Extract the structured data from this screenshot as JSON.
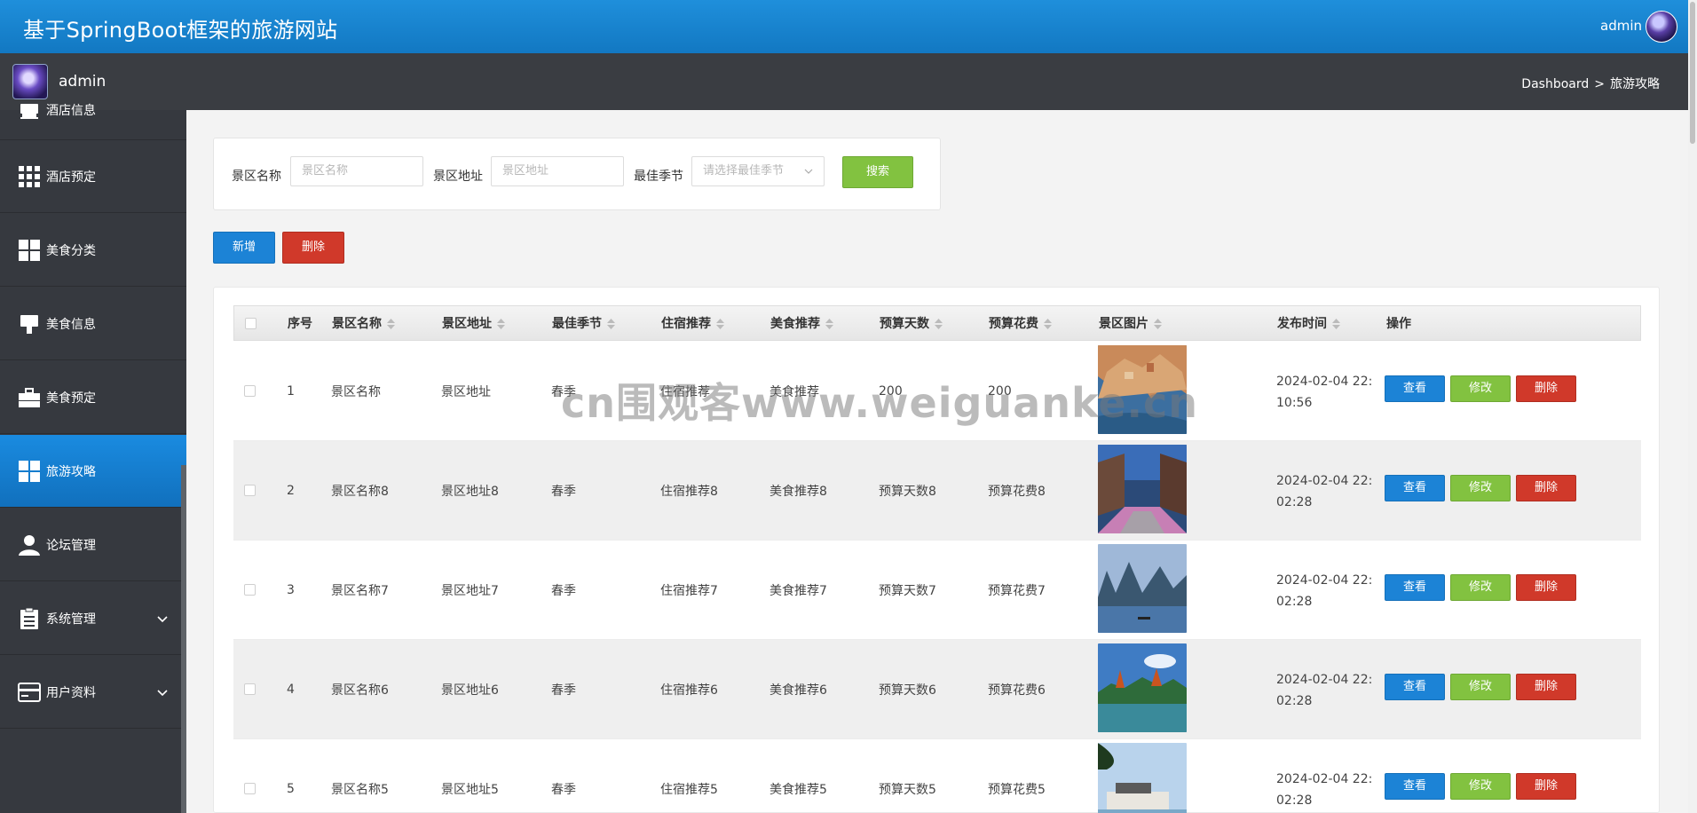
{
  "header": {
    "title": "基于SpringBoot框架的旅游网站",
    "user": "admin"
  },
  "subheader": {
    "user": "admin",
    "breadcrumb": [
      "Dashboard",
      ">",
      "旅游攻略"
    ]
  },
  "sidebar": {
    "items": [
      {
        "label": "酒店信息",
        "icon": "hotel-icon"
      },
      {
        "label": "酒店预定",
        "icon": "grid-icon"
      },
      {
        "label": "美食分类",
        "icon": "category-icon"
      },
      {
        "label": "美食信息",
        "icon": "food-icon"
      },
      {
        "label": "美食预定",
        "icon": "briefcase-icon"
      },
      {
        "label": "旅游攻略",
        "icon": "category-icon",
        "active": true
      },
      {
        "label": "论坛管理",
        "icon": "user-icon"
      },
      {
        "label": "系统管理",
        "icon": "clipboard-icon",
        "expandable": true
      },
      {
        "label": "用户资料",
        "icon": "card-icon",
        "expandable": true
      }
    ]
  },
  "search": {
    "name_label": "景区名称",
    "name_placeholder": "景区名称",
    "addr_label": "景区地址",
    "addr_placeholder": "景区地址",
    "season_label": "最佳季节",
    "season_placeholder": "请选择最佳季节",
    "search_button": "搜索"
  },
  "actions": {
    "add": "新增",
    "delete": "删除"
  },
  "table": {
    "headers": [
      "序号",
      "景区名称",
      "景区地址",
      "最佳季节",
      "住宿推荐",
      "美食推荐",
      "预算天数",
      "预算花费",
      "景区图片",
      "发布时间",
      "操作"
    ],
    "row_buttons": {
      "view": "查看",
      "edit": "修改",
      "delete": "删除"
    },
    "rows": [
      {
        "no": "1",
        "name": "景区名称",
        "addr": "景区地址",
        "season": "春季",
        "stay": "住宿推荐",
        "food": "美食推荐",
        "days": "200",
        "cost": "200",
        "time_l1": "2024-02-04 22:",
        "time_l2": "10:56"
      },
      {
        "no": "2",
        "name": "景区名称8",
        "addr": "景区地址8",
        "season": "春季",
        "stay": "住宿推荐8",
        "food": "美食推荐8",
        "days": "预算天数8",
        "cost": "预算花费8",
        "time_l1": "2024-02-04 22:",
        "time_l2": "02:28"
      },
      {
        "no": "3",
        "name": "景区名称7",
        "addr": "景区地址7",
        "season": "春季",
        "stay": "住宿推荐7",
        "food": "美食推荐7",
        "days": "预算天数7",
        "cost": "预算花费7",
        "time_l1": "2024-02-04 22:",
        "time_l2": "02:28"
      },
      {
        "no": "4",
        "name": "景区名称6",
        "addr": "景区地址6",
        "season": "春季",
        "stay": "住宿推荐6",
        "food": "美食推荐6",
        "days": "预算天数6",
        "cost": "预算花费6",
        "time_l1": "2024-02-04 22:",
        "time_l2": "02:28"
      },
      {
        "no": "5",
        "name": "景区名称5",
        "addr": "景区地址5",
        "season": "春季",
        "stay": "住宿推荐5",
        "food": "美食推荐5",
        "days": "预算天数5",
        "cost": "预算花费5",
        "time_l1": "2024-02-04 22:",
        "time_l2": "02:28"
      }
    ]
  },
  "watermark": "cn围观客www.weiguanke.cn",
  "colors": {
    "primary": "#1c83d6",
    "success": "#82c240",
    "danger": "#d0392a",
    "sidebar": "#36393f",
    "subbar": "#3a3d42"
  }
}
